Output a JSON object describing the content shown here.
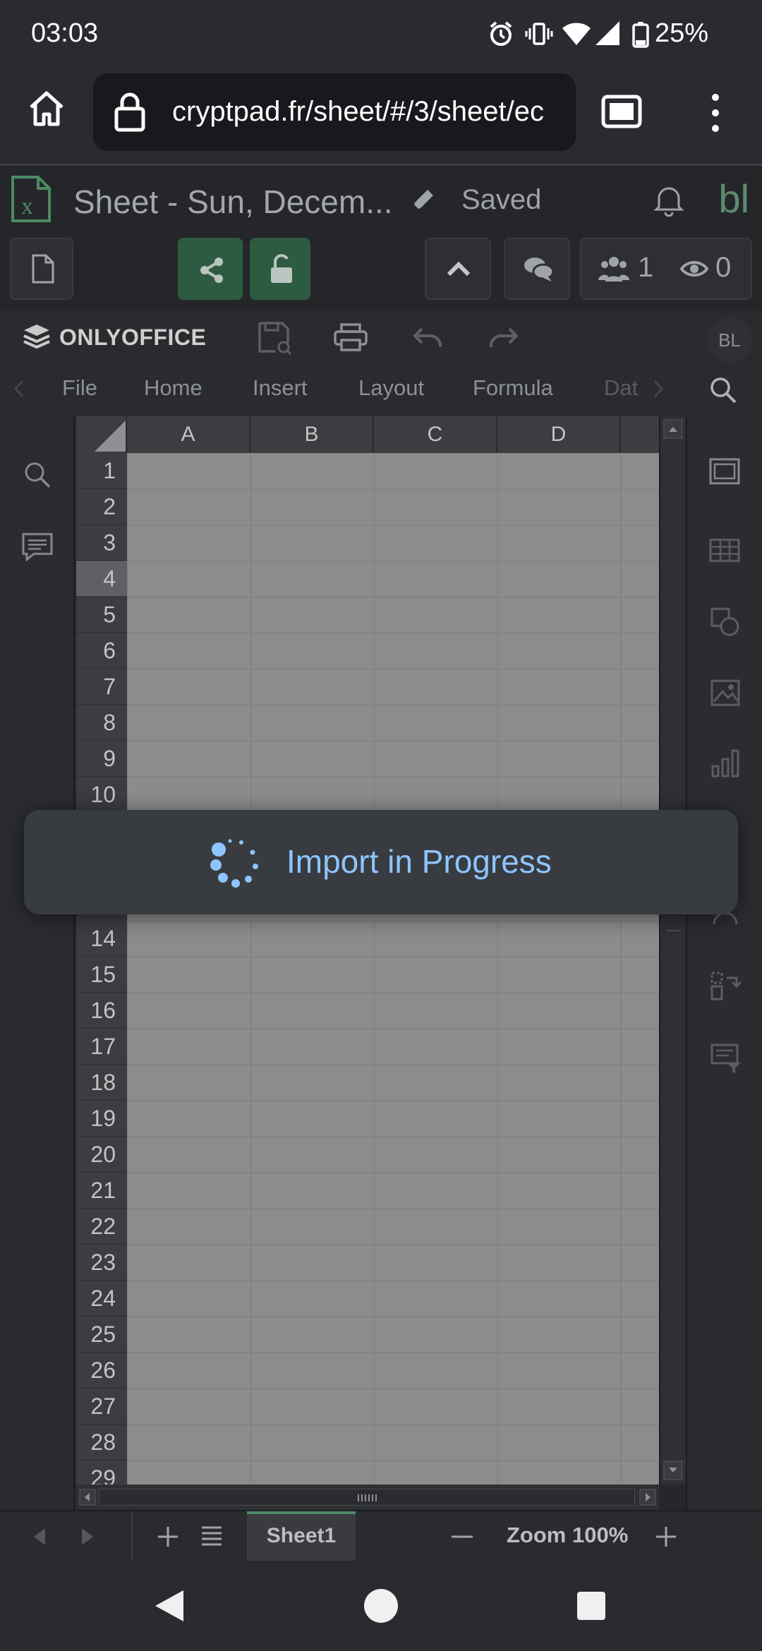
{
  "status_bar": {
    "time": "03:03",
    "battery": "25%"
  },
  "browser": {
    "url": "cryptpad.fr/sheet/#/3/sheet/ec"
  },
  "cryptpad": {
    "doc_title": "Sheet - Sun, Decem...",
    "save_status": "Saved",
    "user_initials": "bl",
    "editors_count": "1",
    "viewers_count": "0"
  },
  "onlyoffice": {
    "brand": "ONLYOFFICE",
    "avatar": "BL",
    "tabs": [
      "File",
      "Home",
      "Insert",
      "Layout",
      "Formula",
      "Dat"
    ]
  },
  "sheet": {
    "columns": [
      "A",
      "B",
      "C",
      "D"
    ],
    "rows": [
      "1",
      "2",
      "3",
      "4",
      "5",
      "6",
      "7",
      "8",
      "9",
      "10",
      "14",
      "15",
      "16",
      "17",
      "18",
      "19",
      "20",
      "21",
      "22",
      "23",
      "24",
      "25",
      "26",
      "27",
      "28",
      "29"
    ],
    "selected_row": "4"
  },
  "overlay": {
    "message": "Import in Progress"
  },
  "bottom": {
    "sheet_tab": "Sheet1",
    "zoom": "Zoom 100%"
  }
}
